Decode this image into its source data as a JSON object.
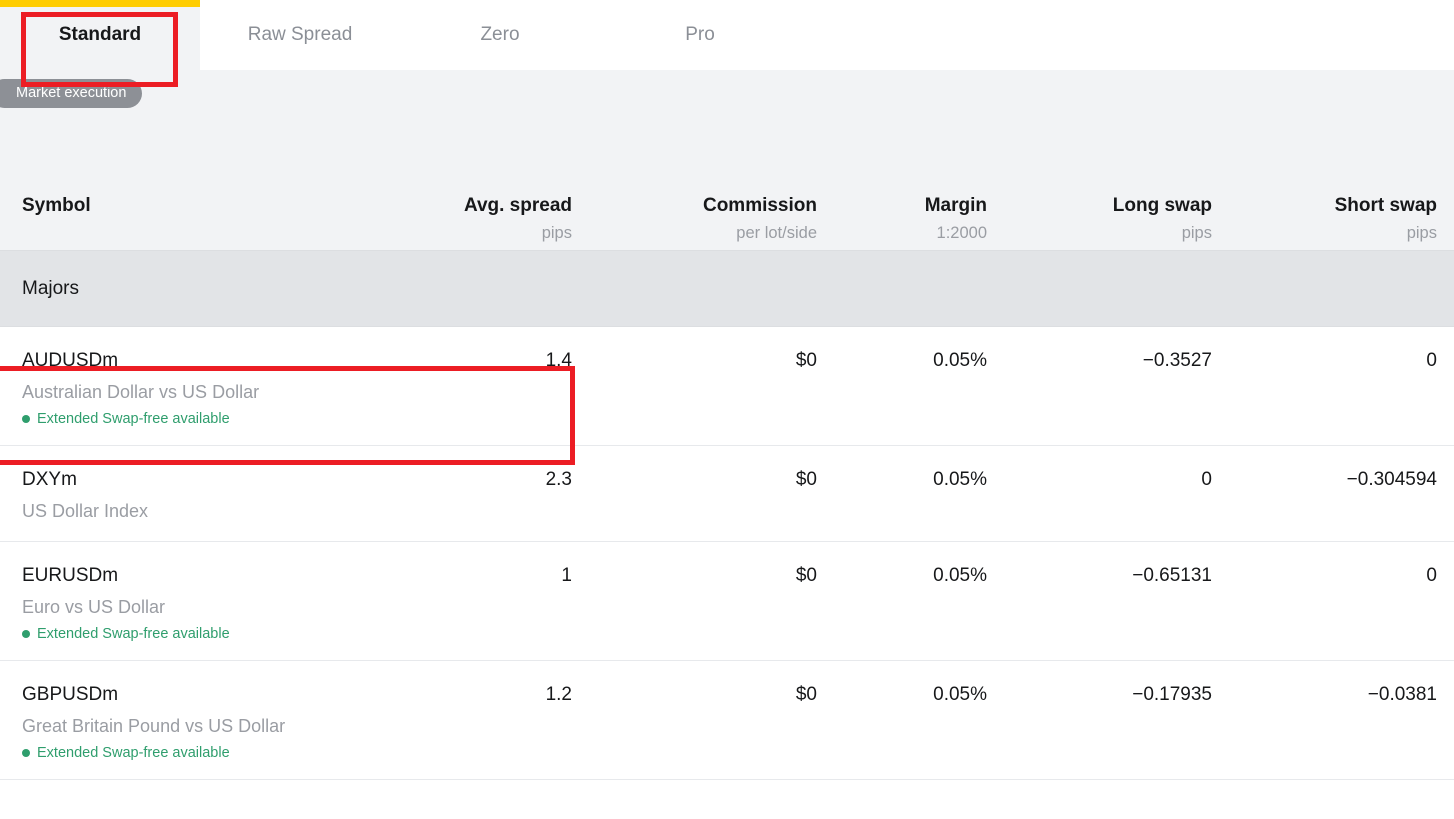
{
  "accent_color": "#ffcd00",
  "annotation_color": "#ec1d24",
  "swapfree_color": "#2f9e6d",
  "tabs": [
    {
      "label": "Standard",
      "active": true
    },
    {
      "label": "Raw Spread",
      "active": false
    },
    {
      "label": "Zero",
      "active": false
    },
    {
      "label": "Pro",
      "active": false
    }
  ],
  "badge": {
    "label": "Market execution"
  },
  "table": {
    "headers": [
      {
        "main": "Symbol",
        "sub": ""
      },
      {
        "main": "Avg. spread",
        "sub": "pips"
      },
      {
        "main": "Commission",
        "sub": "per lot/side"
      },
      {
        "main": "Margin",
        "sub": "1:2000"
      },
      {
        "main": "Long swap",
        "sub": "pips"
      },
      {
        "main": "Short swap",
        "sub": "pips"
      }
    ],
    "group_label": "Majors",
    "rows": [
      {
        "symbol": "AUDUSDm",
        "description": "Australian Dollar vs US Dollar",
        "swap_free": "Extended Swap-free available",
        "avg_spread": "1.4",
        "commission": "$0",
        "margin": "0.05%",
        "long_swap": "−0.3527",
        "short_swap": "0"
      },
      {
        "symbol": "DXYm",
        "description": "US Dollar Index",
        "swap_free": "",
        "avg_spread": "2.3",
        "commission": "$0",
        "margin": "0.05%",
        "long_swap": "0",
        "short_swap": "−0.304594"
      },
      {
        "symbol": "EURUSDm",
        "description": "Euro vs US Dollar",
        "swap_free": "Extended Swap-free available",
        "avg_spread": "1",
        "commission": "$0",
        "margin": "0.05%",
        "long_swap": "−0.65131",
        "short_swap": "0"
      },
      {
        "symbol": "GBPUSDm",
        "description": "Great Britain Pound vs US Dollar",
        "swap_free": "Extended Swap-free available",
        "avg_spread": "1.2",
        "commission": "$0",
        "margin": "0.05%",
        "long_swap": "−0.17935",
        "short_swap": "−0.0381"
      }
    ]
  }
}
